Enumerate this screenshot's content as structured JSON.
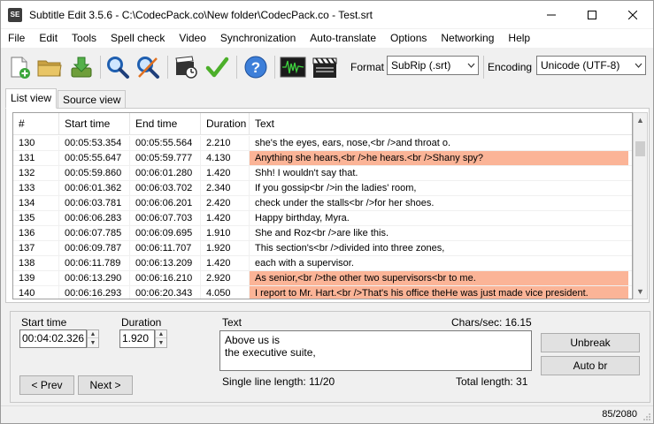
{
  "window": {
    "app_icon": "SE",
    "title": "Subtitle Edit 3.5.6 - C:\\CodecPack.co\\New folder\\CodecPack.co - Test.srt",
    "controls": [
      "minimize-icon",
      "maximize-icon",
      "close-icon"
    ]
  },
  "menu": [
    "File",
    "Edit",
    "Tools",
    "Spell check",
    "Video",
    "Synchronization",
    "Auto-translate",
    "Options",
    "Networking",
    "Help"
  ],
  "toolbar": {
    "icons": [
      "new-file-icon",
      "open-folder-icon",
      "save-download-icon",
      "find-magnifier-icon",
      "replace-magnifier-icon",
      "visual-sync-icon",
      "spell-check-icon",
      "help-icon",
      "waveform-icon",
      "video-clapper-icon"
    ],
    "format_label": "Format",
    "format_value": "SubRip (.srt)",
    "encoding_label": "Encoding",
    "encoding_value": "Unicode (UTF-8)"
  },
  "tabs": [
    "List view",
    "Source view"
  ],
  "list": {
    "columns": [
      "#",
      "Start time",
      "End time",
      "Duration",
      "Text"
    ],
    "highlight_color": "#fbb497",
    "rows": [
      {
        "num": "130",
        "start": "00:05:53.354",
        "end": "00:05:55.564",
        "dur": "2.210",
        "text": "she's the eyes, ears, nose,<br />and throat o.",
        "hl": false
      },
      {
        "num": "131",
        "start": "00:05:55.647",
        "end": "00:05:59.777",
        "dur": "4.130",
        "text": "Anything she hears,<br />he hears.<br />Shany spy?",
        "hl": true
      },
      {
        "num": "132",
        "start": "00:05:59.860",
        "end": "00:06:01.280",
        "dur": "1.420",
        "text": "Shh! I wouldn't say that.",
        "hl": false
      },
      {
        "num": "133",
        "start": "00:06:01.362",
        "end": "00:06:03.702",
        "dur": "2.340",
        "text": "If you gossip<br />in the ladies' room,",
        "hl": false
      },
      {
        "num": "134",
        "start": "00:06:03.781",
        "end": "00:06:06.201",
        "dur": "2.420",
        "text": "check under the stalls<br />for her shoes.",
        "hl": false
      },
      {
        "num": "135",
        "start": "00:06:06.283",
        "end": "00:06:07.703",
        "dur": "1.420",
        "text": "Happy birthday, Myra.",
        "hl": false
      },
      {
        "num": "136",
        "start": "00:06:07.785",
        "end": "00:06:09.695",
        "dur": "1.910",
        "text": "She and Roz<br />are like this.",
        "hl": false
      },
      {
        "num": "137",
        "start": "00:06:09.787",
        "end": "00:06:11.707",
        "dur": "1.920",
        "text": "This section's<br />divided into three zones,",
        "hl": false
      },
      {
        "num": "138",
        "start": "00:06:11.789",
        "end": "00:06:13.209",
        "dur": "1.420",
        "text": "each with a supervisor.",
        "hl": false
      },
      {
        "num": "139",
        "start": "00:06:13.290",
        "end": "00:06:16.210",
        "dur": "2.920",
        "text": "As senior,<br />the other two supervisors<br to me.",
        "hl": true
      },
      {
        "num": "140",
        "start": "00:06:16.293",
        "end": "00:06:20.343",
        "dur": "4.050",
        "text": "I report to Mr. Hart.<br />That's his office theHe was just made vice president.",
        "hl": true
      }
    ]
  },
  "editor": {
    "start_time_label": "Start time",
    "start_time_value": "00:04:02.326",
    "duration_label": "Duration",
    "duration_value": "1.920",
    "text_label": "Text",
    "chars_sec": "Chars/sec: 16.15",
    "text_line1": "Above us is",
    "text_line2": "the executive suite,",
    "single_line_length": "Single line length: 11/20",
    "total_length": "Total length: 31",
    "unbreak_label": "Unbreak",
    "auto_br_label": "Auto br",
    "prev_label": "< Prev",
    "next_label": "Next >"
  },
  "status": {
    "position": "85/2080"
  }
}
